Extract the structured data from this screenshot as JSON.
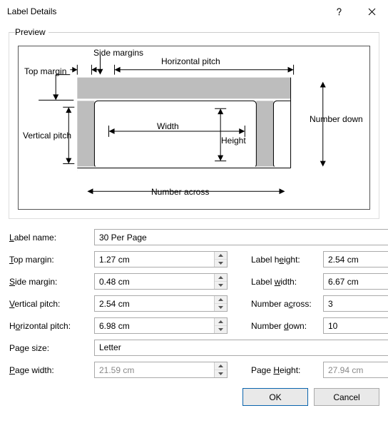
{
  "titlebar": {
    "title": "Label Details"
  },
  "preview": {
    "legend": "Preview",
    "labels": {
      "side_margins": "Side margins",
      "top_margin": "Top margin",
      "horizontal_pitch": "Horizontal pitch",
      "number_down": "Number down",
      "vertical_pitch": "Vertical pitch",
      "width": "Width",
      "height": "Height",
      "number_across": "Number across"
    }
  },
  "fields": {
    "label_name": {
      "label": "Label name:",
      "value": "30 Per Page"
    },
    "top_margin": {
      "label": "Top margin:",
      "value": "1.27 cm"
    },
    "side_margin": {
      "label": "Side margin:",
      "value": "0.48 cm"
    },
    "vertical_pitch": {
      "label": "Vertical pitch:",
      "value": "2.54 cm"
    },
    "horizontal_pitch": {
      "label": "Horizontal pitch:",
      "value": "6.98 cm"
    },
    "label_height": {
      "label": "Label height:",
      "value": "2.54 cm"
    },
    "label_width": {
      "label": "Label width:",
      "value": "6.67 cm"
    },
    "number_across": {
      "label": "Number across:",
      "value": "3"
    },
    "number_down": {
      "label": "Number down:",
      "value": "10"
    },
    "page_size": {
      "label": "Page size:",
      "value": "Letter"
    },
    "page_width": {
      "label": "Page width:",
      "value": "21.59 cm"
    },
    "page_height": {
      "label": "Page Height:",
      "value": "27.94 cm"
    }
  },
  "buttons": {
    "ok": "OK",
    "cancel": "Cancel"
  }
}
